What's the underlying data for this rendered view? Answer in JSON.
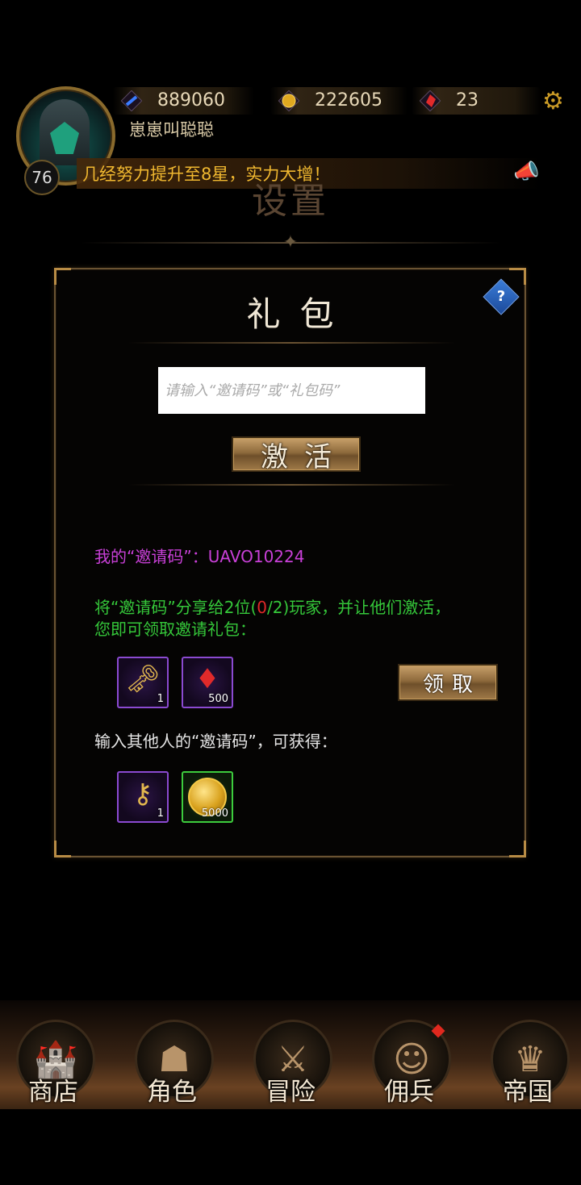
{
  "header": {
    "resources": [
      {
        "icon": "blue-scroll-icon",
        "value": "889060"
      },
      {
        "icon": "gold-coin-icon",
        "value": "222605"
      },
      {
        "icon": "red-gem-icon",
        "value": "23"
      }
    ],
    "username": "崽崽叫聪聪",
    "level": "76",
    "news": "几经努力提升至8星，实力大增！"
  },
  "page_title": "设置",
  "panel": {
    "title": "礼包",
    "help_label": "?",
    "input_placeholder": "请输入“邀请码”或“礼包码”",
    "activate_label": "激活",
    "invite_prefix": "我的“邀请码”：",
    "invite_code": "UAVO10224",
    "share_text_a": "将“邀请码”分享给2位(",
    "share_count": "0",
    "share_text_b": "/2)玩家，并让他们激活，",
    "share_text_c": "您即可领取邀请礼包：",
    "claim_label": "领取",
    "other_text": "输入其他人的“邀请码”，可获得：",
    "invite_rewards": [
      {
        "icon": "key-bundle-icon",
        "count": "1"
      },
      {
        "icon": "ruby-icon",
        "count": "500"
      }
    ],
    "enter_rewards": [
      {
        "icon": "key-icon",
        "count": "1"
      },
      {
        "icon": "gold-coin-icon",
        "count": "5000"
      }
    ]
  },
  "bottom_nav": [
    {
      "label": "商店",
      "icon": "shop-castle-icon"
    },
    {
      "label": "角色",
      "icon": "hooded-character-icon"
    },
    {
      "label": "冒险",
      "icon": "crossed-swords-icon"
    },
    {
      "label": "佣兵",
      "icon": "mercenary-card-icon"
    },
    {
      "label": "帝国",
      "icon": "crown-icon"
    }
  ],
  "colors": {
    "invite_text": "#c940d8",
    "share_text": "#35c83a",
    "share_count": "#e02828",
    "news_text": "#f0b830"
  }
}
